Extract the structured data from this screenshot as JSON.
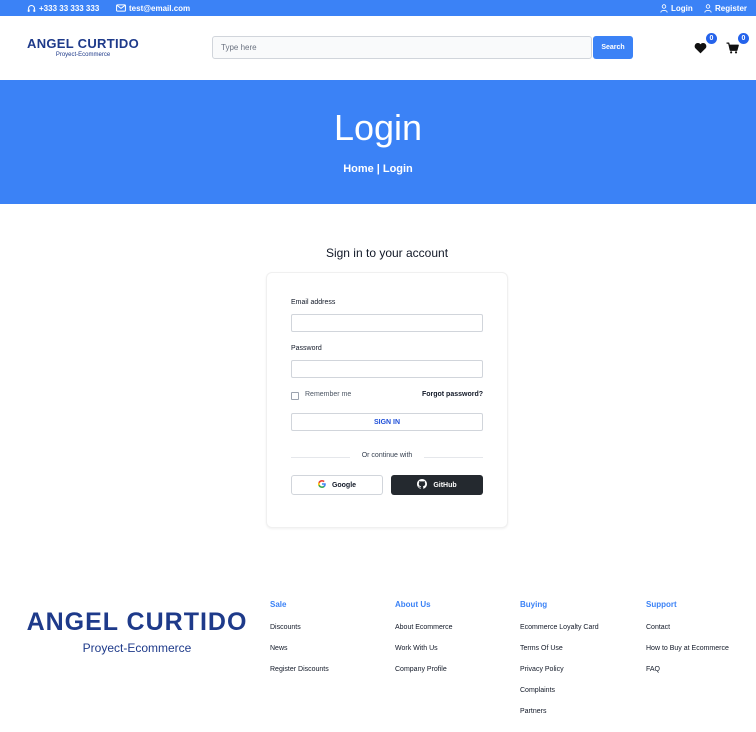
{
  "topbar": {
    "phone": "+333 33 333 333",
    "email": "test@email.com",
    "login": "Login",
    "register": "Register"
  },
  "header": {
    "brand_name": "ANGEL CURTIDO",
    "brand_sub": "Proyect-Ecommerce",
    "search_placeholder": "Type here",
    "search_button": "Search",
    "wishlist_count": "0",
    "cart_count": "0"
  },
  "hero": {
    "title": "Login",
    "breadcrumb_home": "Home",
    "breadcrumb_sep": "|",
    "breadcrumb_current": "Login"
  },
  "login": {
    "heading": "Sign in to your account",
    "email_label": "Email address",
    "password_label": "Password",
    "remember_label": "Remember me",
    "forgot_label": "Forgot password?",
    "signin_button": "SIGN IN",
    "continue_text": "Or continue with",
    "google_button": "Google",
    "github_button": "GitHub"
  },
  "footer": {
    "brand_name": "ANGEL CURTIDO",
    "brand_sub": "Proyect-Ecommerce",
    "columns": [
      {
        "title": "Sale",
        "links": [
          "Discounts",
          "News",
          "Register Discounts"
        ]
      },
      {
        "title": "About Us",
        "links": [
          "About Ecommerce",
          "Work With Us",
          "Company Profile"
        ]
      },
      {
        "title": "Buying",
        "links": [
          "Ecommerce Loyalty Card",
          "Terms Of Use",
          "Privacy Policy",
          "Complaints",
          "Partners"
        ]
      },
      {
        "title": "Support",
        "links": [
          "Contact",
          "How to Buy at Ecommerce",
          "FAQ"
        ]
      }
    ]
  },
  "colors": {
    "primary": "#3b82f6",
    "brand": "#1e3a8a",
    "github_bg": "#24292f"
  }
}
